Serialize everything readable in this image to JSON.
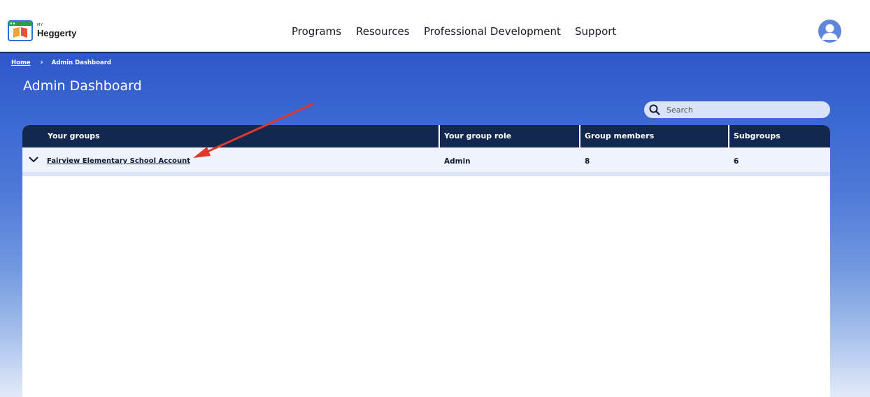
{
  "brand": {
    "small": "MY",
    "name": "Heggerty"
  },
  "nav": {
    "items": [
      "Programs",
      "Resources",
      "Professional Development",
      "Support"
    ]
  },
  "breadcrumb": {
    "home": "Home",
    "separator": "›",
    "current": "Admin Dashboard"
  },
  "page": {
    "title": "Admin Dashboard"
  },
  "search": {
    "placeholder": "Search",
    "value": ""
  },
  "table": {
    "headers": [
      "Your groups",
      "Your group role",
      "Group members",
      "Subgroups"
    ],
    "rows": [
      {
        "group": "Fairview Elementary School Account",
        "role": "Admin",
        "members": "8",
        "subgroups": "6"
      }
    ]
  },
  "colors": {
    "nav_border": "#12305f",
    "hero_top": "#2f57c8",
    "table_header": "#12284f",
    "row_bg": "#eef3fc",
    "annotation_arrow": "#e0392b"
  },
  "icons": [
    "heggerty-logo-icon",
    "user-avatar-icon",
    "breadcrumb-chevron-icon",
    "search-icon",
    "chevron-down-icon"
  ]
}
